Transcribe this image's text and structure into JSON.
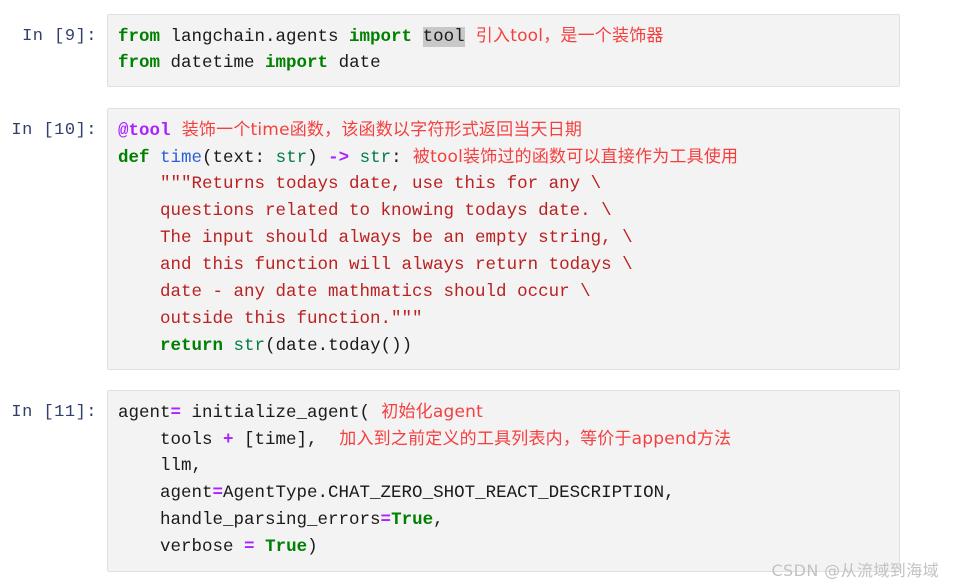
{
  "notebook": {
    "cells": [
      {
        "prompt": "In [9]:",
        "lines": [
          {
            "tokens": [
              {
                "t": "from",
                "c": "kw"
              },
              {
                "t": " langchain.agents ",
                "c": "plain"
              },
              {
                "t": "import",
                "c": "kw"
              },
              {
                "t": " ",
                "c": "plain"
              },
              {
                "t": "tool",
                "c": "plain hl"
              }
            ],
            "note": "引入tool，是一个装饰器"
          },
          {
            "tokens": [
              {
                "t": "from",
                "c": "kw"
              },
              {
                "t": " datetime ",
                "c": "plain"
              },
              {
                "t": "import",
                "c": "kw"
              },
              {
                "t": " date",
                "c": "plain"
              }
            ],
            "note": ""
          }
        ]
      },
      {
        "prompt": "In [10]:",
        "lines": [
          {
            "tokens": [
              {
                "t": "@tool",
                "c": "deco"
              }
            ],
            "note": "装饰一个time函数，该函数以字符形式返回当天日期"
          },
          {
            "tokens": [
              {
                "t": "def",
                "c": "kw"
              },
              {
                "t": " ",
                "c": "plain"
              },
              {
                "t": "time",
                "c": "fname"
              },
              {
                "t": "(text: ",
                "c": "plain"
              },
              {
                "t": "str",
                "c": "builtin"
              },
              {
                "t": ") ",
                "c": "plain"
              },
              {
                "t": "->",
                "c": "op"
              },
              {
                "t": " ",
                "c": "plain"
              },
              {
                "t": "str",
                "c": "builtin"
              },
              {
                "t": ":",
                "c": "plain"
              }
            ],
            "note": "被tool装饰过的函数可以直接作为工具使用"
          },
          {
            "tokens": [
              {
                "t": "    \"\"\"Returns todays date, use this for any \\",
                "c": "doc"
              }
            ],
            "note": ""
          },
          {
            "tokens": [
              {
                "t": "    questions related to knowing todays date. \\",
                "c": "doc"
              }
            ],
            "note": ""
          },
          {
            "tokens": [
              {
                "t": "    The input should always be an empty string, \\",
                "c": "doc"
              }
            ],
            "note": ""
          },
          {
            "tokens": [
              {
                "t": "    and this function will always return todays \\",
                "c": "doc"
              }
            ],
            "note": ""
          },
          {
            "tokens": [
              {
                "t": "    date - any date mathmatics should occur \\",
                "c": "doc"
              }
            ],
            "note": ""
          },
          {
            "tokens": [
              {
                "t": "    outside this function.\"\"\"",
                "c": "doc"
              }
            ],
            "note": ""
          },
          {
            "tokens": [
              {
                "t": "    ",
                "c": "plain"
              },
              {
                "t": "return",
                "c": "kw"
              },
              {
                "t": " ",
                "c": "plain"
              },
              {
                "t": "str",
                "c": "builtin"
              },
              {
                "t": "(date.today())",
                "c": "plain"
              }
            ],
            "note": ""
          }
        ]
      },
      {
        "prompt": "In [11]:",
        "lines": [
          {
            "tokens": [
              {
                "t": "agent",
                "c": "plain"
              },
              {
                "t": "=",
                "c": "op"
              },
              {
                "t": " initialize_agent(",
                "c": "plain"
              }
            ],
            "note": "初始化agent"
          },
          {
            "tokens": [
              {
                "t": "    tools ",
                "c": "plain"
              },
              {
                "t": "+",
                "c": "op"
              },
              {
                "t": " [time], ",
                "c": "plain"
              }
            ],
            "note": "加入到之前定义的工具列表内，等价于append方法"
          },
          {
            "tokens": [
              {
                "t": "    llm,",
                "c": "plain"
              }
            ],
            "note": ""
          },
          {
            "tokens": [
              {
                "t": "    agent",
                "c": "plain"
              },
              {
                "t": "=",
                "c": "op"
              },
              {
                "t": "AgentType.CHAT_ZERO_SHOT_REACT_DESCRIPTION,",
                "c": "plain"
              }
            ],
            "note": ""
          },
          {
            "tokens": [
              {
                "t": "    handle_parsing_errors",
                "c": "plain"
              },
              {
                "t": "=",
                "c": "op"
              },
              {
                "t": "True",
                "c": "bool"
              },
              {
                "t": ",",
                "c": "plain"
              }
            ],
            "note": ""
          },
          {
            "tokens": [
              {
                "t": "    verbose ",
                "c": "plain"
              },
              {
                "t": "=",
                "c": "op"
              },
              {
                "t": " ",
                "c": "plain"
              },
              {
                "t": "True",
                "c": "bool"
              },
              {
                "t": ")",
                "c": "plain"
              }
            ],
            "note": ""
          }
        ]
      }
    ]
  },
  "watermark": {
    "text": "CSDN @从流域到海域"
  },
  "colors": {
    "keyword": "#008000",
    "decorator": "#aa22ff",
    "operator": "#aa22ff",
    "docstring": "#ba2121",
    "function_name": "#2b5fd9",
    "builtin": "#007d45",
    "annotation": "#f43f3f",
    "prompt": "#303f6b",
    "cell_background": "#f3f3f3",
    "cell_border": "#e0e0e0",
    "highlight": "#c8c8c8",
    "watermark": "#c2c2c2"
  }
}
